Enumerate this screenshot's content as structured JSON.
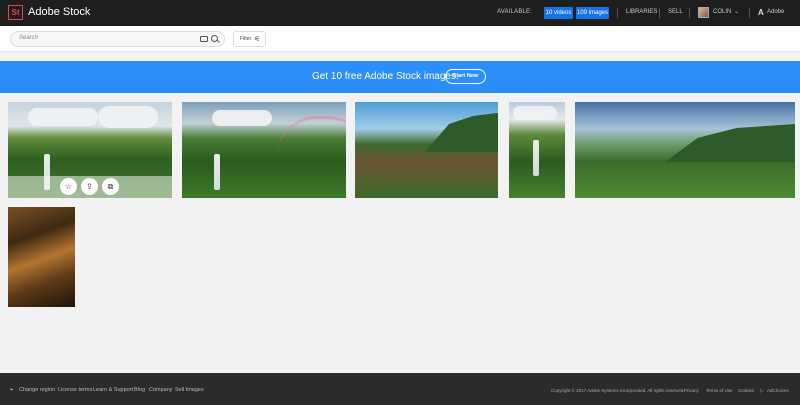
{
  "header": {
    "logo": "St",
    "brand": "Adobe Stock",
    "available_label": "AVAILABLE:",
    "videos_badge": "10 videos",
    "images_badge": "109 images",
    "nav": [
      "LIBRARIES",
      "SELL"
    ],
    "user_name": "COLIN",
    "adobe_label": "Adobe",
    "colors": {
      "bar": "#1e1e1e",
      "badge": "#1473e6",
      "logo": "#e34850"
    }
  },
  "search": {
    "placeholder": "Search",
    "filter_label": "Filter"
  },
  "banner": {
    "text": "Get 10 free Adobe Stock images.",
    "button": "Start Now",
    "color": "#2c8ef8"
  },
  "results": {
    "items": [
      {
        "subject": "waterfall in green valley",
        "hovered": true
      },
      {
        "subject": "waterfall with rainbow"
      },
      {
        "subject": "coastal mountain ridge with rainbow"
      },
      {
        "subject": "waterfall vertical"
      },
      {
        "subject": "coastline panorama"
      },
      {
        "subject": "rock texture close-up"
      }
    ],
    "hover_actions": [
      "like-icon",
      "license-icon",
      "similar-icon"
    ]
  },
  "footer": {
    "links": [
      "Change region",
      "License terms",
      "Learn & Support",
      "Blog",
      "Company",
      "Sell Images"
    ],
    "copyright": "Copyright © 2017 Adobe Systems Incorporated. All rights reserved.",
    "right_links": [
      "Privacy",
      "Terms of Use",
      "Cookies",
      "AdChoices"
    ]
  }
}
